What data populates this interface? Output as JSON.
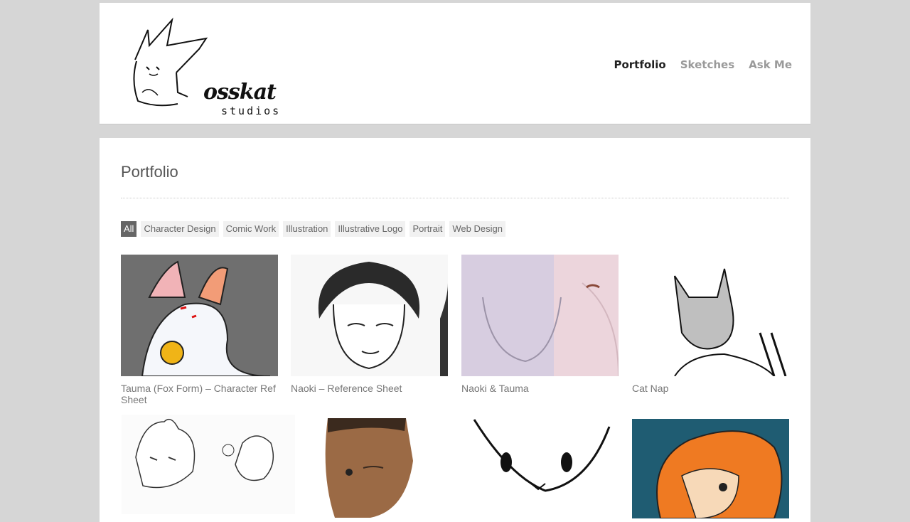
{
  "header": {
    "logo_word": "osskat",
    "logo_sub": "studios",
    "nav": [
      {
        "label": "Portfolio",
        "active": true
      },
      {
        "label": "Sketches",
        "active": false
      },
      {
        "label": "Ask Me",
        "active": false
      }
    ]
  },
  "main": {
    "title": "Portfolio",
    "filters": [
      {
        "label": "All",
        "active": true
      },
      {
        "label": "Character Design",
        "active": false
      },
      {
        "label": "Comic Work",
        "active": false
      },
      {
        "label": "Illustration",
        "active": false
      },
      {
        "label": "Illustrative Logo",
        "active": false
      },
      {
        "label": "Portrait",
        "active": false
      },
      {
        "label": "Web Design",
        "active": false
      }
    ],
    "items": [
      {
        "caption": "Tauma (Fox Form) – Character Ref Sheet"
      },
      {
        "caption": "Naoki – Reference Sheet"
      },
      {
        "caption": "Naoki & Tauma"
      },
      {
        "caption": "Cat Nap"
      }
    ]
  },
  "colors": {
    "page_bg": "#d6d6d6",
    "card_bg": "#ffffff",
    "active_filter": "#666666"
  }
}
